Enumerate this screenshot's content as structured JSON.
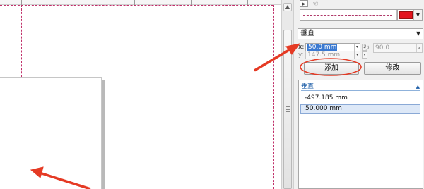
{
  "docker": {
    "top_icons": [
      "cursor-arrow-icon",
      "pointer-hand-icon"
    ],
    "line_style": {
      "value": "dashed"
    },
    "guide_color": "#e3141e",
    "orientation": {
      "selected": "垂直"
    },
    "x": {
      "label": "x:",
      "value": "50.0 mm"
    },
    "y": {
      "label": "y:",
      "value": "147.5 mm"
    },
    "angle": {
      "value": "90.0"
    },
    "add_label": "添加",
    "edit_label": "修改",
    "guides_list": {
      "header": "垂直",
      "items": [
        "-497.185 mm",
        "50.000 mm"
      ],
      "selected_index": 1
    }
  },
  "annotation_color": "#e53a24"
}
